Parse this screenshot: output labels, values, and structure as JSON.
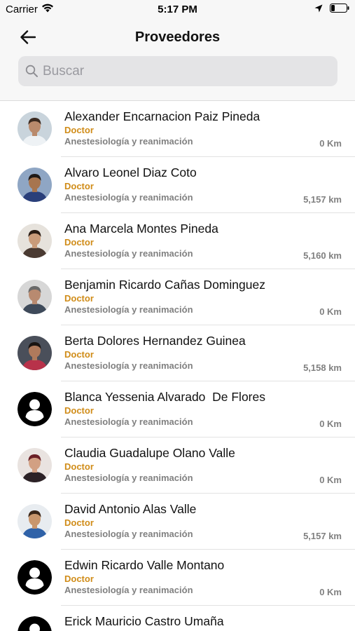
{
  "status_bar": {
    "carrier": "Carrier",
    "time": "5:17 PM"
  },
  "header": {
    "title": "Proveedores"
  },
  "search": {
    "placeholder": "Buscar",
    "value": ""
  },
  "colors": {
    "role": "#d08c18",
    "secondary_text": "#808080",
    "header_bg": "#f7f7f7",
    "search_bg": "#e4e4e6"
  },
  "providers": [
    {
      "name": "Alexander Encarnacion Paiz Pineda",
      "role": "Doctor",
      "specialty": "Anestesiología y reanimación",
      "distance": "0 Km",
      "avatar": "photo"
    },
    {
      "name": "Alvaro Leonel Diaz Coto",
      "role": "Doctor",
      "specialty": "Anestesiología y reanimación",
      "distance": "5,157 km",
      "avatar": "photo"
    },
    {
      "name": "Ana Marcela Montes Pineda",
      "role": "Doctor",
      "specialty": "Anestesiología y reanimación",
      "distance": "5,160 km",
      "avatar": "photo"
    },
    {
      "name": "Benjamin Ricardo Cañas Dominguez",
      "role": "Doctor",
      "specialty": "Anestesiología y reanimación",
      "distance": "0 Km",
      "avatar": "photo"
    },
    {
      "name": "Berta Dolores Hernandez Guinea",
      "role": "Doctor",
      "specialty": "Anestesiología y reanimación",
      "distance": "5,158 km",
      "avatar": "photo"
    },
    {
      "name": "Blanca Yessenia Alvarado  De Flores",
      "role": "Doctor",
      "specialty": "Anestesiología y reanimación",
      "distance": "0 Km",
      "avatar": "default-user-icon"
    },
    {
      "name": "Claudia Guadalupe Olano Valle",
      "role": "Doctor",
      "specialty": "Anestesiología y reanimación",
      "distance": "0 Km",
      "avatar": "photo"
    },
    {
      "name": "David Antonio Alas Valle",
      "role": "Doctor",
      "specialty": "Anestesiología y reanimación",
      "distance": "5,157 km",
      "avatar": "photo"
    },
    {
      "name": "Edwin Ricardo Valle Montano",
      "role": "Doctor",
      "specialty": "Anestesiología y reanimación",
      "distance": "0 Km",
      "avatar": "default-user-icon"
    },
    {
      "name": "Erick Mauricio Castro Umaña",
      "role": "",
      "specialty": "",
      "distance": "",
      "avatar": "default-user-icon"
    }
  ]
}
